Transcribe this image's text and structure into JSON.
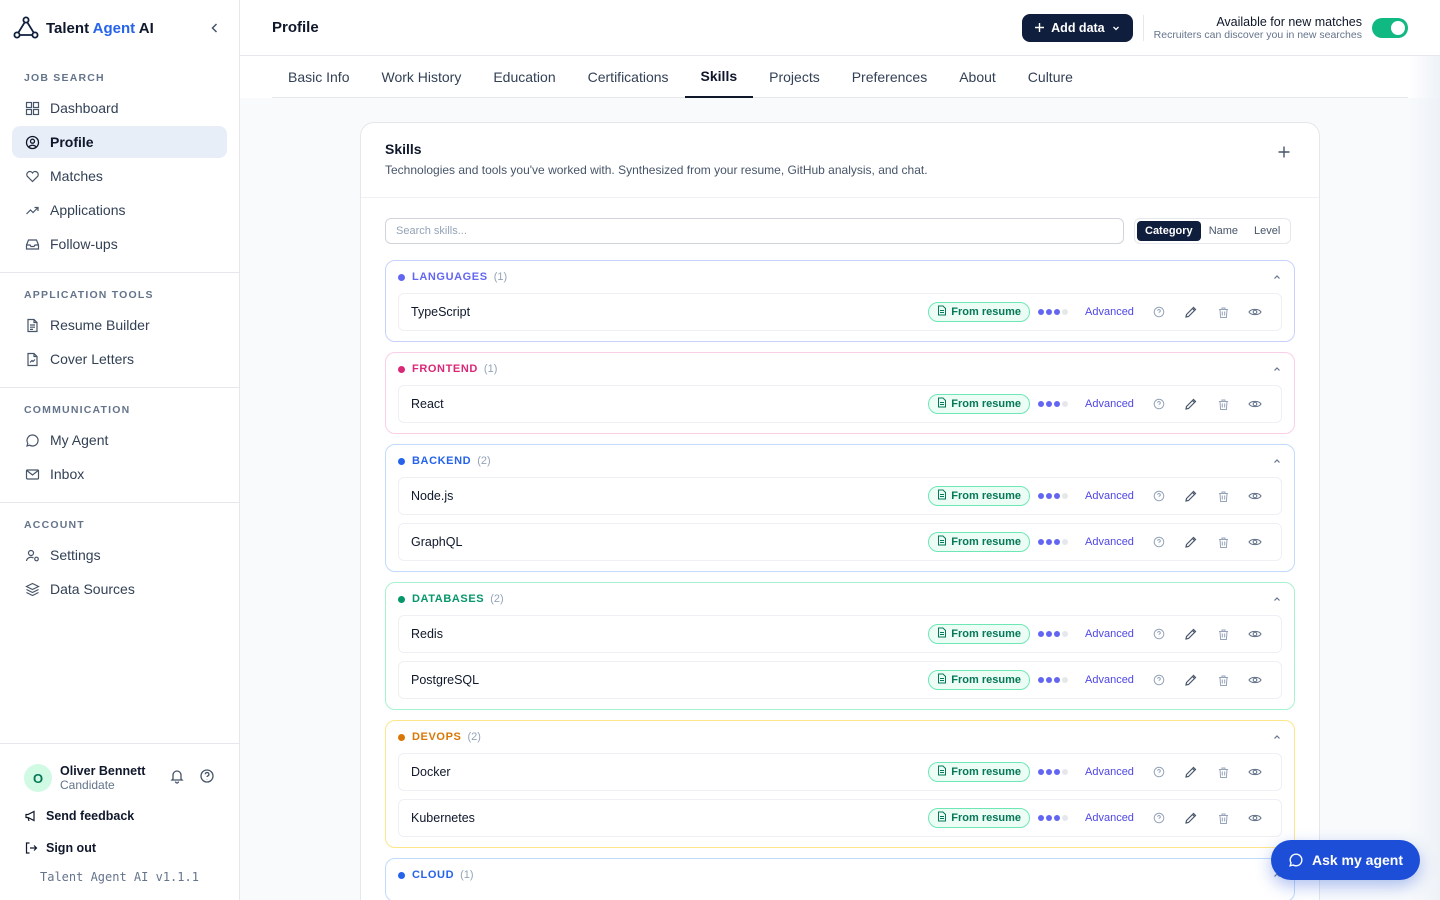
{
  "brand": {
    "name_primary": "Talent ",
    "name_accent": "Agent",
    "name_suffix": " AI"
  },
  "sidebar": {
    "sections": [
      {
        "heading": "JOB SEARCH",
        "items": [
          {
            "label": "Dashboard",
            "icon": "grid-icon"
          },
          {
            "label": "Profile",
            "icon": "user-circle-icon",
            "active": true
          },
          {
            "label": "Matches",
            "icon": "heart-icon"
          },
          {
            "label": "Applications",
            "icon": "trending-up-icon"
          },
          {
            "label": "Follow-ups",
            "icon": "inbox-tray-icon"
          }
        ]
      },
      {
        "heading": "APPLICATION TOOLS",
        "items": [
          {
            "label": "Resume Builder",
            "icon": "file-text-icon"
          },
          {
            "label": "Cover Letters",
            "icon": "file-signature-icon"
          }
        ]
      },
      {
        "heading": "COMMUNICATION",
        "items": [
          {
            "label": "My Agent",
            "icon": "chat-bubble-icon"
          },
          {
            "label": "Inbox",
            "icon": "mail-icon"
          }
        ]
      },
      {
        "heading": "ACCOUNT",
        "items": [
          {
            "label": "Settings",
            "icon": "user-cog-icon"
          },
          {
            "label": "Data Sources",
            "icon": "layers-icon"
          }
        ]
      }
    ],
    "user": {
      "initial": "O",
      "name": "Oliver Bennett",
      "role": "Candidate"
    },
    "send_feedback": "Send feedback",
    "sign_out": "Sign out",
    "version": "Talent Agent AI v1.1.1"
  },
  "header": {
    "title": "Profile",
    "add_data": "Add data",
    "availability_title": "Available for new matches",
    "availability_sub": "Recruiters can discover you in new searches",
    "availability_on": true
  },
  "tabs": [
    "Basic Info",
    "Work History",
    "Education",
    "Certifications",
    "Skills",
    "Projects",
    "Preferences",
    "About",
    "Culture"
  ],
  "active_tab": "Skills",
  "skills_card": {
    "title": "Skills",
    "subtitle": "Technologies and tools you've worked with. Synthesized from your resume, GitHub analysis, and chat.",
    "search_placeholder": "Search skills...",
    "sort_options": [
      "Category",
      "Name",
      "Level"
    ],
    "sort_active": "Category",
    "groups": [
      {
        "name": "LANGUAGES",
        "count": "(1)",
        "color": "#6366f1",
        "border": "#c7d2fe",
        "skills": [
          {
            "name": "TypeScript",
            "source": "From resume",
            "level": "Advanced",
            "level_value": 3,
            "level_max": 4
          }
        ]
      },
      {
        "name": "FRONTEND",
        "count": "(1)",
        "color": "#db2777",
        "border": "#fbcfe8",
        "skills": [
          {
            "name": "React",
            "source": "From resume",
            "level": "Advanced",
            "level_value": 3,
            "level_max": 4
          }
        ]
      },
      {
        "name": "BACKEND",
        "count": "(2)",
        "color": "#2563eb",
        "border": "#bfdbfe",
        "skills": [
          {
            "name": "Node.js",
            "source": "From resume",
            "level": "Advanced",
            "level_value": 3,
            "level_max": 4
          },
          {
            "name": "GraphQL",
            "source": "From resume",
            "level": "Advanced",
            "level_value": 3,
            "level_max": 4
          }
        ]
      },
      {
        "name": "DATABASES",
        "count": "(2)",
        "color": "#059669",
        "border": "#a7f3d0",
        "skills": [
          {
            "name": "Redis",
            "source": "From resume",
            "level": "Advanced",
            "level_value": 3,
            "level_max": 4
          },
          {
            "name": "PostgreSQL",
            "source": "From resume",
            "level": "Advanced",
            "level_value": 3,
            "level_max": 4
          }
        ]
      },
      {
        "name": "DEVOPS",
        "count": "(2)",
        "color": "#d97706",
        "border": "#fde68a",
        "skills": [
          {
            "name": "Docker",
            "source": "From resume",
            "level": "Advanced",
            "level_value": 3,
            "level_max": 4
          },
          {
            "name": "Kubernetes",
            "source": "From resume",
            "level": "Advanced",
            "level_value": 3,
            "level_max": 4
          }
        ]
      },
      {
        "name": "CLOUD",
        "count": "(1)",
        "color": "#2563eb",
        "border": "#bfdbfe",
        "skills": []
      }
    ]
  },
  "ask_agent": "Ask my agent"
}
